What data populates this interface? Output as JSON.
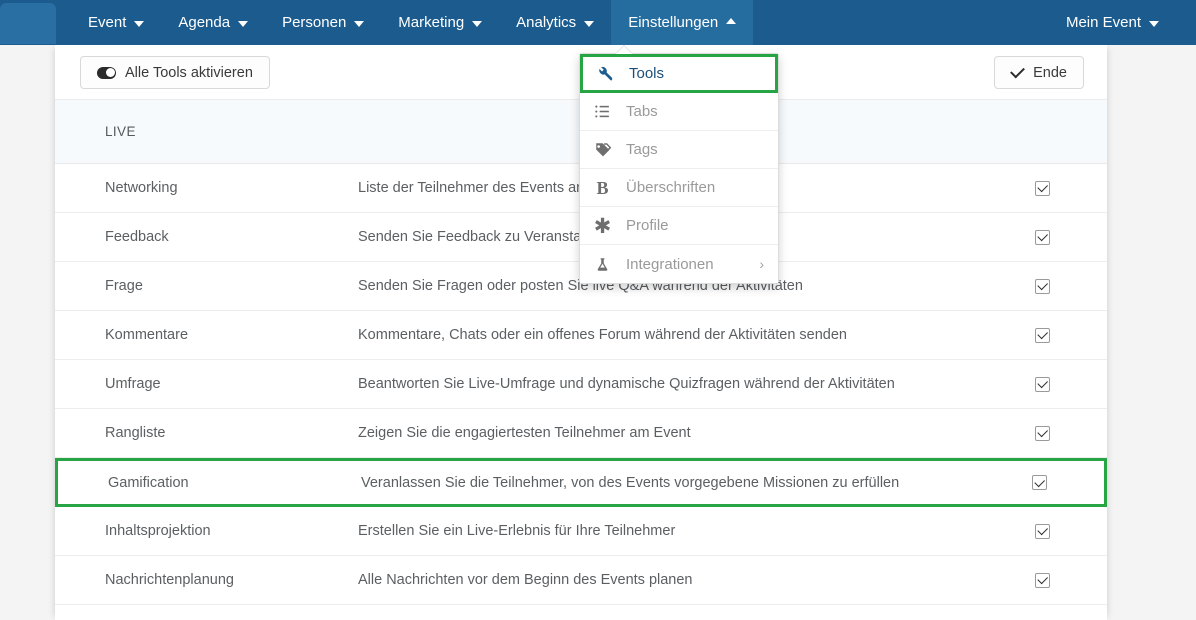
{
  "navbar": {
    "logo_name": "app-logo",
    "items": [
      {
        "label": "Event",
        "icon": "chevron-down-icon",
        "active": false
      },
      {
        "label": "Agenda",
        "icon": "chevron-down-icon",
        "active": false
      },
      {
        "label": "Personen",
        "icon": "chevron-down-icon",
        "active": false
      },
      {
        "label": "Marketing",
        "icon": "chevron-down-icon",
        "active": false
      },
      {
        "label": "Analytics",
        "icon": "chevron-down-icon",
        "active": false
      },
      {
        "label": "Einstellungen",
        "icon": "chevron-up-icon",
        "active": true
      }
    ],
    "account": {
      "label": "Mein Event",
      "icon": "chevron-down-icon"
    },
    "background_color": "#1b5b8e",
    "active_color": "#256c9f"
  },
  "dropdown": {
    "items": [
      {
        "label": "Tools",
        "icon": "wrench-icon",
        "active": true,
        "chevron": ""
      },
      {
        "label": "Tabs",
        "icon": "list-icon",
        "active": false,
        "chevron": ""
      },
      {
        "label": "Tags",
        "icon": "tag-icon",
        "active": false,
        "chevron": ""
      },
      {
        "label": "Überschriften",
        "icon": "bold-text-icon",
        "active": false,
        "chevron": ""
      },
      {
        "label": "Profile",
        "icon": "asterisk-icon",
        "active": false,
        "chevron": ""
      },
      {
        "label": "Integrationen",
        "icon": "flask-icon",
        "active": false,
        "chevron": "›"
      }
    ],
    "highlight_color": "#27a444"
  },
  "toolbar": {
    "toggle_all_label": "Alle Tools aktivieren",
    "toggle_all_icon": "toggle-on-icon",
    "end_label": "Ende",
    "end_icon": "check-icon"
  },
  "table": {
    "group_header": "LIVE",
    "rows": [
      {
        "name": "Networking",
        "description": "Liste der Teilnehmer des Events anzeigen",
        "checked": true,
        "highlighted": false
      },
      {
        "name": "Feedback",
        "description": "Senden Sie Feedback zu Veranstaltungen",
        "checked": true,
        "highlighted": false
      },
      {
        "name": "Frage",
        "description": "Senden Sie Fragen oder posten Sie live Q&A während der Aktivitäten",
        "checked": true,
        "highlighted": false
      },
      {
        "name": "Kommentare",
        "description": "Kommentare, Chats oder ein offenes Forum während der Aktivitäten senden",
        "checked": true,
        "highlighted": false
      },
      {
        "name": "Umfrage",
        "description": "Beantworten Sie Live-Umfrage und dynamische Quizfragen während der Aktivitäten",
        "checked": true,
        "highlighted": false
      },
      {
        "name": "Rangliste",
        "description": "Zeigen Sie die engagiertesten Teilnehmer am Event",
        "checked": true,
        "highlighted": false
      },
      {
        "name": "Gamification",
        "description": "Veranlassen Sie die Teilnehmer, von des Events vorgegebene Missionen zu erfüllen",
        "checked": true,
        "highlighted": true
      },
      {
        "name": "Inhaltsprojektion",
        "description": "Erstellen Sie ein Live-Erlebnis für Ihre Teilnehmer",
        "checked": true,
        "highlighted": false
      },
      {
        "name": "Nachrichtenplanung",
        "description": "Alle Nachrichten vor dem Beginn des Events planen",
        "checked": true,
        "highlighted": false
      }
    ]
  }
}
